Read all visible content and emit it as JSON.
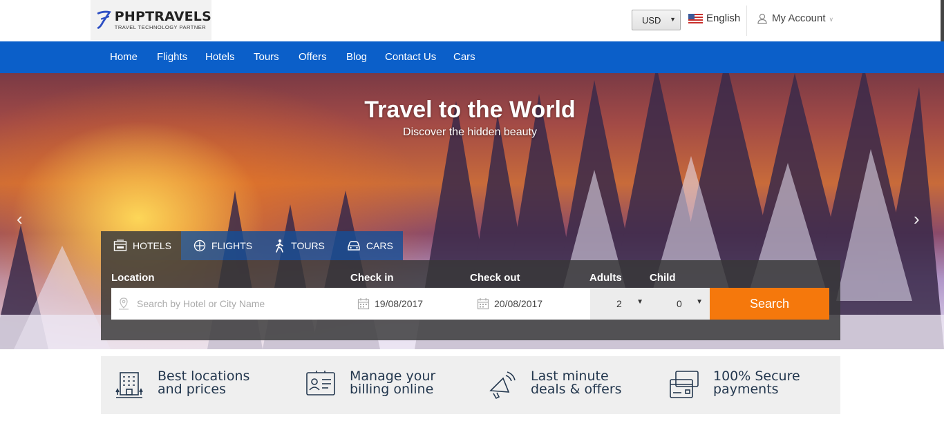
{
  "brand": {
    "name": "PHPTRAVELS",
    "tagline": "TRAVEL TECHNOLOGY PARTNER"
  },
  "header": {
    "currency": "USD",
    "language": "English",
    "account": "My Account"
  },
  "nav": {
    "items": [
      {
        "label": "Home"
      },
      {
        "label": "Flights"
      },
      {
        "label": "Hotels"
      },
      {
        "label": "Tours"
      },
      {
        "label": "Offers"
      },
      {
        "label": "Blog"
      },
      {
        "label": "Contact Us"
      },
      {
        "label": "Cars"
      }
    ]
  },
  "hero": {
    "title": "Travel to the World",
    "subtitle": "Discover the hidden beauty"
  },
  "search": {
    "tabs": [
      {
        "label": "HOTELS",
        "icon": "hotel-icon",
        "active": true
      },
      {
        "label": "FLIGHTS",
        "icon": "plane-icon",
        "active": false
      },
      {
        "label": "TOURS",
        "icon": "hiker-icon",
        "active": false
      },
      {
        "label": "CARS",
        "icon": "car-icon",
        "active": false
      }
    ],
    "labels": {
      "location": "Location",
      "checkin": "Check in",
      "checkout": "Check out",
      "adults": "Adults",
      "child": "Child"
    },
    "location_placeholder": "Search by Hotel or City Name",
    "checkin_value": "19/08/2017",
    "checkout_value": "20/08/2017",
    "adults_value": "2",
    "child_value": "0",
    "button": "Search"
  },
  "features": [
    {
      "line1": "Best locations",
      "line2": "and prices",
      "icon": "building-icon"
    },
    {
      "line1": "Manage your",
      "line2": "billing online",
      "icon": "id-card-icon"
    },
    {
      "line1": "Last minute",
      "line2": "deals & offers",
      "icon": "megaphone-icon"
    },
    {
      "line1": "100% Secure",
      "line2": "payments",
      "icon": "credit-card-icon"
    }
  ],
  "colors": {
    "nav_blue": "#0b5fc9",
    "accent_orange": "#f5780c",
    "feature_text": "#23374e"
  }
}
